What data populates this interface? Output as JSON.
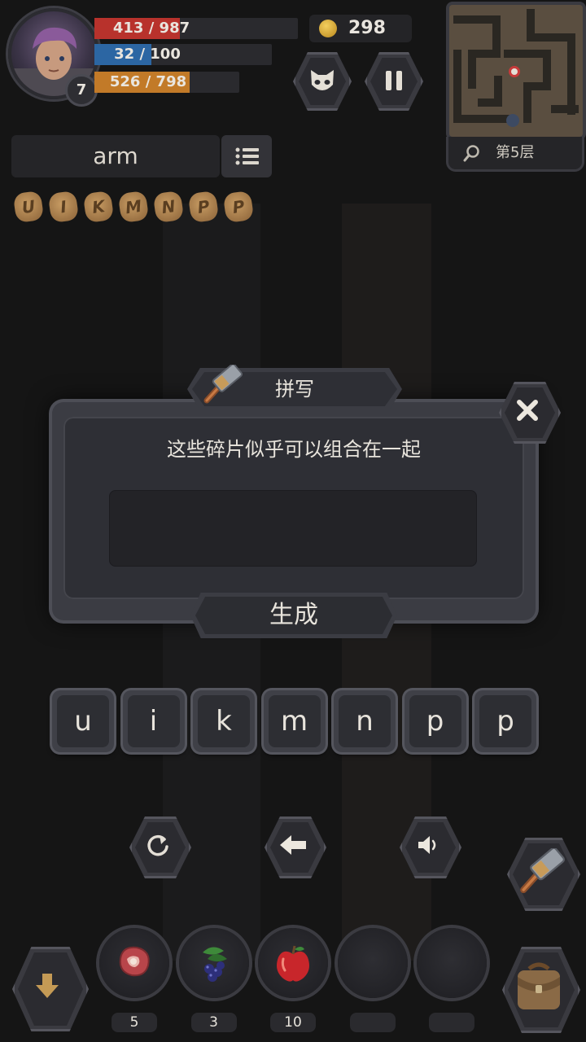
{
  "player": {
    "level": "7",
    "hp_text": "413 / 987",
    "hp_fraction": 0.418,
    "mp_text": "32 / 100",
    "mp_fraction": 0.32,
    "xp_text": "526 / 798",
    "xp_fraction": 0.659
  },
  "currency": {
    "coins": "298"
  },
  "minimap": {
    "floor_label": "第5层"
  },
  "word_panel": {
    "current_word": "arm",
    "rune_fragments": [
      "U",
      "I",
      "K",
      "M",
      "N",
      "P",
      "P"
    ]
  },
  "dialog": {
    "title": "拼写",
    "message": "这些碎片似乎可以组合在一起",
    "input_value": "",
    "generate_label": "生成"
  },
  "letter_tiles": [
    "u",
    "i",
    "k",
    "m",
    "n",
    "p",
    "p"
  ],
  "inventory": {
    "slots": [
      {
        "icon": "meat-icon",
        "count": "5"
      },
      {
        "icon": "berries-icon",
        "count": "3"
      },
      {
        "icon": "apple-icon",
        "count": "10"
      },
      {
        "icon": "empty-slot",
        "count": ""
      },
      {
        "icon": "empty-slot",
        "count": ""
      }
    ]
  },
  "colors": {
    "hp": "#c0352f",
    "mp": "#2f6aa6",
    "xp": "#c87e2a",
    "rune": "#b58954"
  }
}
